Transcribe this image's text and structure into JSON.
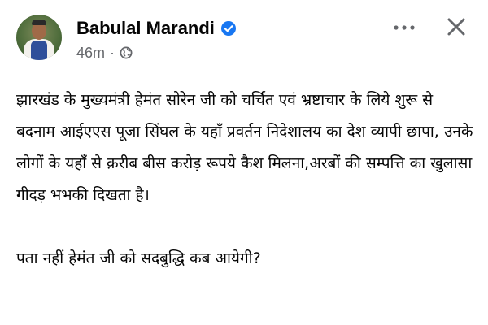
{
  "post": {
    "author": "Babulal Marandi",
    "time": "46m",
    "separator": "·",
    "paragraphs": [
      "झारखंड के मुख्यमंत्री हेमंत सोरेन जी को चर्चित एवं भ्रष्टाचार के लिये शुरू से बदनाम आईएएस पूजा सिंघल के यहाँ प्रवर्तन निदेशालय का देश व्यापी छापा, उनके लोगों के यहाँ से क़रीब बीस करोड़ रूपये कैश मिलना,अरबों की सम्पत्ति का खुलासा गीदड़ भभकी दिखता है।",
      "पता नहीं हेमंत जी को सदबुद्धि कब आयेगी?"
    ]
  },
  "icons": {
    "verified": "verified-badge-icon",
    "audience": "globe-icon",
    "more": "more-options-icon",
    "close": "close-icon"
  },
  "colors": {
    "verified_blue": "#1877f2",
    "meta_gray": "#65676b",
    "text": "#050505"
  }
}
